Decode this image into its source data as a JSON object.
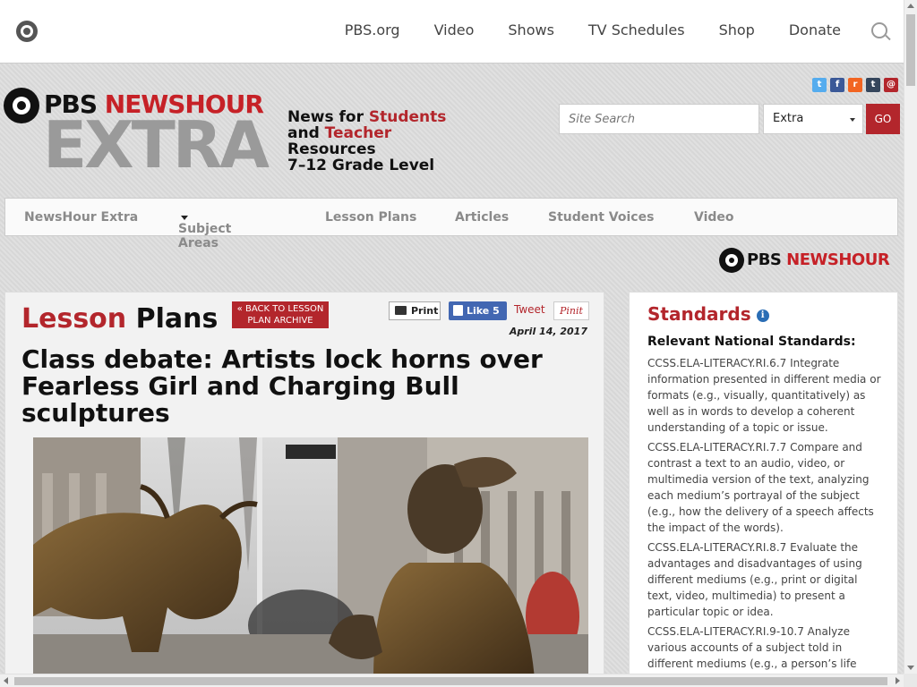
{
  "top_nav": {
    "items": [
      "PBS.org",
      "Video",
      "Shows",
      "TV Schedules",
      "Shop",
      "Donate"
    ]
  },
  "header": {
    "logo_pbs": "PBS",
    "logo_newshour": "NEWSHOUR",
    "logo_extra": "EXTRA",
    "tagline": {
      "line1_prefix": "News for ",
      "line1_highlight": "Students",
      "line2_prefix": "and ",
      "line2_highlight": "Teacher",
      "line3": "Resources",
      "line4": "7–12 Grade Level"
    },
    "search_placeholder": "Site Search",
    "search_scope": "Extra",
    "go_label": "GO",
    "social_icons": [
      "twitter-icon",
      "facebook-icon",
      "rss-icon",
      "tumblr-icon",
      "email-icon"
    ]
  },
  "main_nav": {
    "items": [
      "NewsHour Extra",
      "Subject Areas",
      "Lesson Plans",
      "Articles",
      "Student Voices",
      "Video"
    ]
  },
  "partner_logo": {
    "pbs": "PBS",
    "newshour": "NEWSHOUR"
  },
  "article": {
    "section_red": "Lesson",
    "section_black": "Plans",
    "back_button_line1": "BACK TO LESSON",
    "back_button_line2": "PLAN ARCHIVE",
    "print_label": "Print",
    "like_label": "Like 5",
    "tweet_label": "Tweet",
    "pin_label": "Pinit",
    "date": "April 14, 2017",
    "headline": "Class debate: Artists lock horns over Fearless Girl and Charging Bull sculptures"
  },
  "sidebar": {
    "title": "Standards",
    "subtitle": "Relevant National Standards:",
    "standards": [
      "CCSS.ELA-LITERACY.RI.6.7 Integrate information presented in different media or formats (e.g., visually, quantitatively) as well as in words to develop a coherent understanding of a topic or issue.",
      "CCSS.ELA-LITERACY.RI.7.7 Compare and contrast a text to an audio, video, or multimedia version of the text, analyzing each medium’s portrayal of the subject (e.g., how the delivery of a speech affects the impact of the words).",
      "CCSS.ELA-LITERACY.RI.8.7 Evaluate the advantages and disadvantages of using different mediums (e.g., print or digital text, video, multimedia) to present a particular topic or idea.",
      "CCSS.ELA-LITERACY.RI.9-10.7 Analyze various accounts of a subject told in different mediums (e.g., a person’s life"
    ]
  },
  "colors": {
    "accent_red": "#b3262c",
    "facebook_blue": "#4267b2"
  }
}
